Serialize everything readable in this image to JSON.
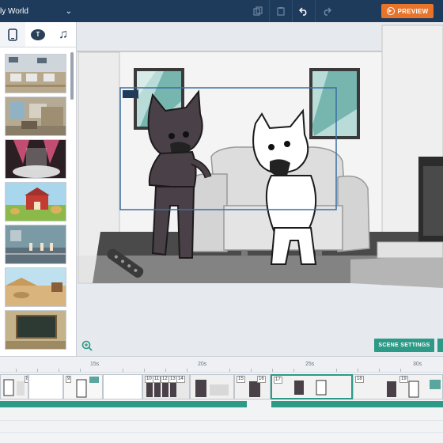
{
  "header": {
    "world_title": "ly World",
    "preview_label": "PREVIEW"
  },
  "sidebar": {
    "tabs": [
      {
        "name": "phone-icon"
      },
      {
        "name": "speech-bubble-icon",
        "glyph": "T"
      },
      {
        "name": "music-note-icon"
      }
    ],
    "thumbnails": [
      "classroom",
      "office-room",
      "stage",
      "farm",
      "basketball-court",
      "desert",
      "chalkboard"
    ]
  },
  "stage": {
    "scene_settings_label": "SCENE SETTINGS"
  },
  "timeline": {
    "ruler_labels": [
      "15s",
      "20s",
      "25s",
      "30s"
    ],
    "clip_numbers": [
      "8",
      "9",
      "10",
      "11",
      "12",
      "13",
      "14",
      "15",
      "16",
      "17",
      "18",
      "19"
    ]
  },
  "colors": {
    "topbar": "#1e3b5c",
    "accent_orange": "#e8742a",
    "accent_teal": "#2c9a87",
    "selection_frame": "#3a6fa3"
  }
}
